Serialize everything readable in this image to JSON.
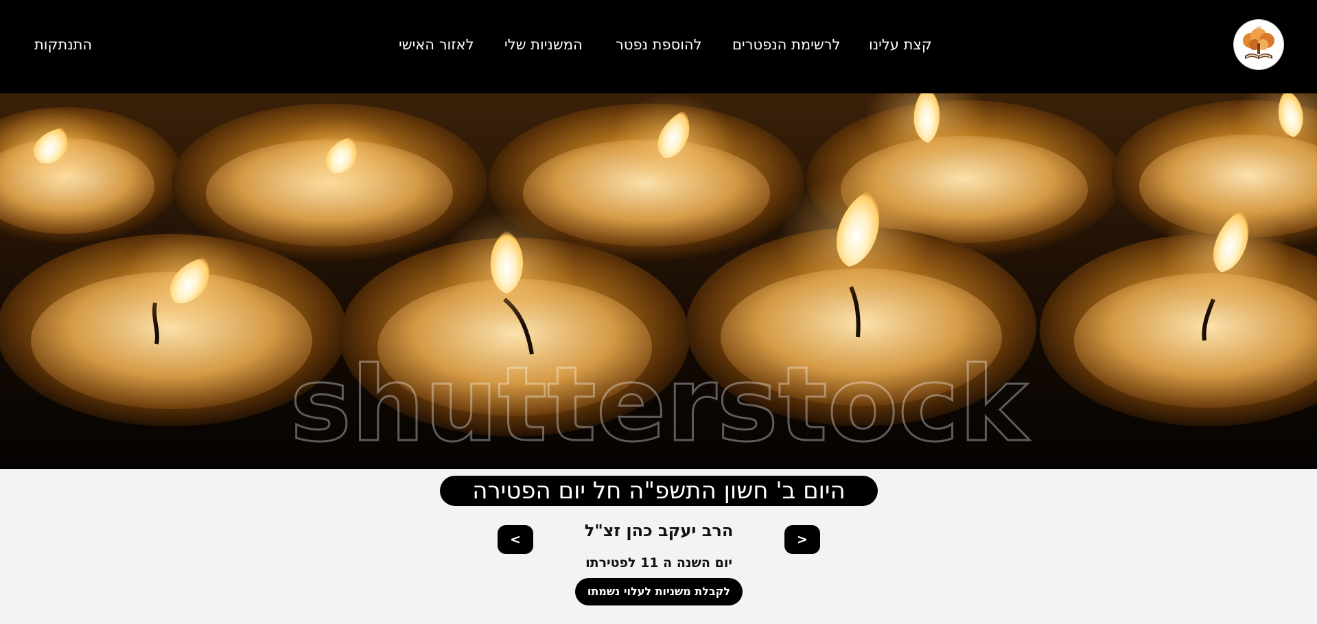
{
  "nav": {
    "logout": "התנתקות",
    "personal_area": "לאזור האישי",
    "my_mishnayot": "המשניות שלי",
    "add_deceased": "להוספת נפטר",
    "deceased_list": "לרשימת הנפטרים",
    "about": "קצת עלינו",
    "logo_icon": "tree-book-logo-icon"
  },
  "hero": {
    "image": "memorial-candles-photo",
    "watermark": "shutterstock"
  },
  "memorial": {
    "date_banner": "היום ב' חשון התשפ\"ה חל יום הפטירה",
    "name": "הרב יעקב כהן זצ\"ל",
    "year_info": "יום השנה ה 11 לפטירתו",
    "prev_label": "<",
    "next_label": ">",
    "cta_label": "לקבלת משניות לעלוי נשמתו"
  },
  "colors": {
    "nav_bg": "#000000",
    "page_bg": "#f4f3f1",
    "accent": "#000000"
  }
}
